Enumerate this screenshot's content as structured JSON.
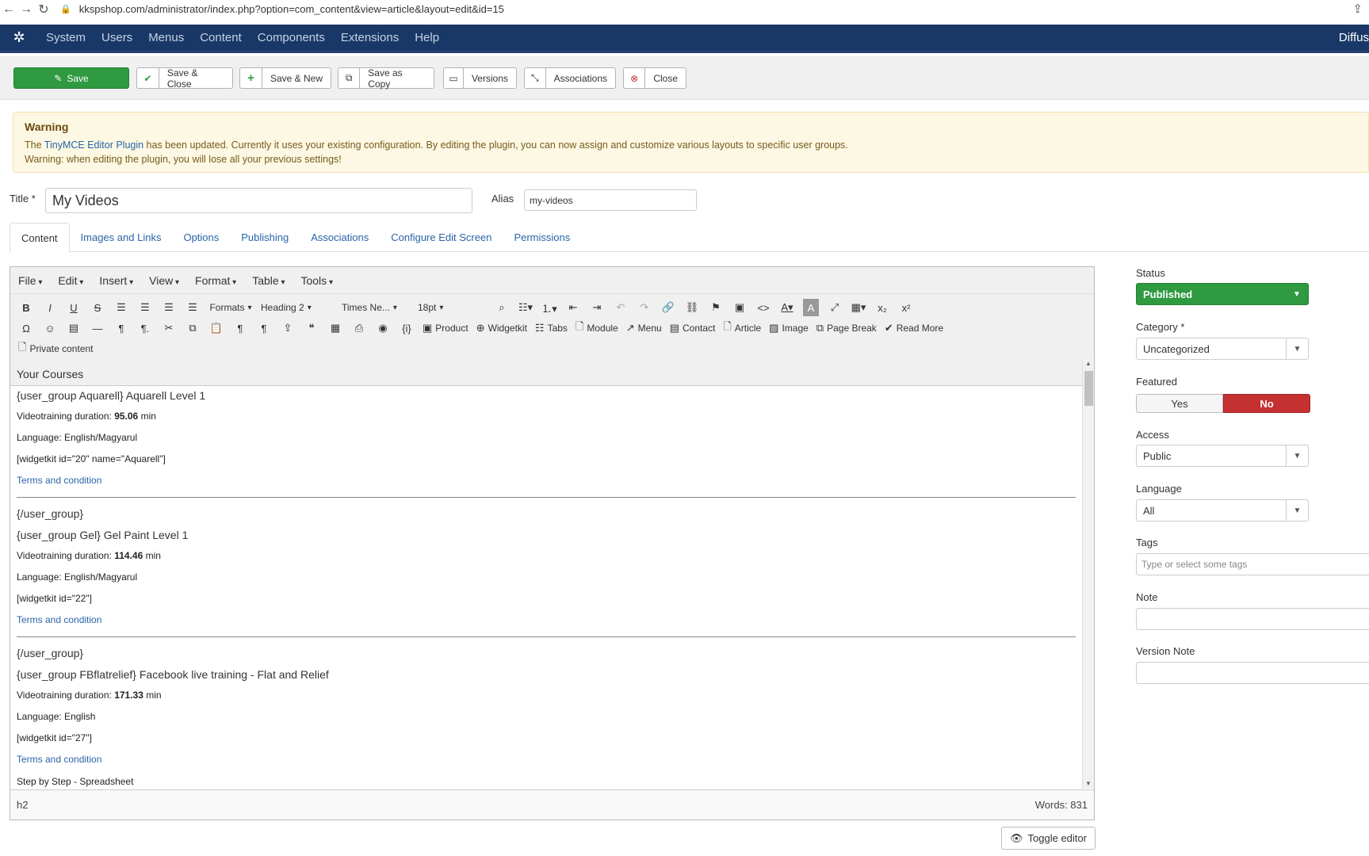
{
  "browser": {
    "back_icon": "back-arrow-icon",
    "forward_icon": "forward-arrow-icon",
    "reload_icon": "reload-icon",
    "url": "kkspshop.com/administrator/index.php?option=com_content&view=article&layout=edit&id=15"
  },
  "admin_nav": {
    "items": [
      "System",
      "Users",
      "Menus",
      "Content",
      "Components",
      "Extensions",
      "Help"
    ],
    "site_name": "Diffus"
  },
  "toolbar": {
    "save": "Save",
    "save_close": "Save & Close",
    "save_new": "Save & New",
    "save_copy": "Save as Copy",
    "versions": "Versions",
    "associations": "Associations",
    "close": "Close"
  },
  "warning": {
    "title": "Warning",
    "line1_pre": "The ",
    "line1_link": "TinyMCE Editor Plugin",
    "line1_post": " has been updated. Currently it uses your existing configuration. By editing the plugin, you can now assign and customize various layouts to specific user groups.",
    "line2": "Warning: when editing the plugin, you will lose all your previous settings!"
  },
  "form": {
    "title_label": "Title *",
    "title_value": "My Videos",
    "alias_label": "Alias",
    "alias_value": "my-videos"
  },
  "tabs": [
    "Content",
    "Images and Links",
    "Options",
    "Publishing",
    "Associations",
    "Configure Edit Screen",
    "Permissions"
  ],
  "editor": {
    "menus": [
      "File",
      "Edit",
      "Insert",
      "View",
      "Format",
      "Table",
      "Tools"
    ],
    "formats_label": "Formats",
    "heading_label": "Heading 2",
    "font_label": "Times Ne...",
    "size_label": "18pt",
    "plugins": [
      "Product",
      "Widgetkit",
      "Tabs",
      "Module",
      "Menu",
      "Contact",
      "Article",
      "Image",
      "Page Break",
      "Read More"
    ],
    "private_content": "Private content",
    "content": {
      "heading": "Your Courses",
      "g1_open": "{user_group Aquarell} Aquarell Level 1",
      "g1_dur_label": "Videotraining duration: ",
      "g1_dur_value": "95.06",
      "g1_dur_unit": " min",
      "g1_lang": "Language: English/Magyarul",
      "g1_widget": "[widgetkit id=\"20\" name=\"Aquarell\"]",
      "g1_terms": "Terms and condition",
      "g2_close": "{/user_group}",
      "g2_open": "{user_group Gel} Gel Paint Level 1",
      "g2_dur_label": "Videotraining duration: ",
      "g2_dur_value": "114.46",
      "g2_dur_unit": " min",
      "g2_lang": "Language: English/Magyarul",
      "g2_widget": "[widgetkit id=\"22\"]",
      "g2_terms": "Terms and condition",
      "g3_close": "{/user_group}",
      "g3_open": "{user_group FBflatrelief} Facebook live training - Flat and Relief",
      "g3_dur_label": "Videotraining duration: ",
      "g3_dur_value": "171.33",
      "g3_dur_unit": " min",
      "g3_lang": "Language: English",
      "g3_widget": "[widgetkit id=\"27\"]",
      "g3_terms": "Terms and condition",
      "g4_partial": "Step by Step - Spreadsheet"
    },
    "status_path": "h2",
    "word_count": "Words: 831"
  },
  "toggle_editor": "Toggle editor",
  "sidebar": {
    "status_label": "Status",
    "status_value": "Published",
    "category_label": "Category *",
    "category_value": "Uncategorized",
    "featured_label": "Featured",
    "featured_yes": "Yes",
    "featured_no": "No",
    "access_label": "Access",
    "access_value": "Public",
    "language_label": "Language",
    "language_value": "All",
    "tags_label": "Tags",
    "tags_placeholder": "Type or select some tags",
    "note_label": "Note",
    "version_note_label": "Version Note"
  },
  "colors": {
    "nav_bg": "#1a3867",
    "save_green": "#2f9a40",
    "featured_no_red": "#c53030",
    "link_blue": "#2a64a8",
    "warning_bg": "#fcf8e3"
  }
}
